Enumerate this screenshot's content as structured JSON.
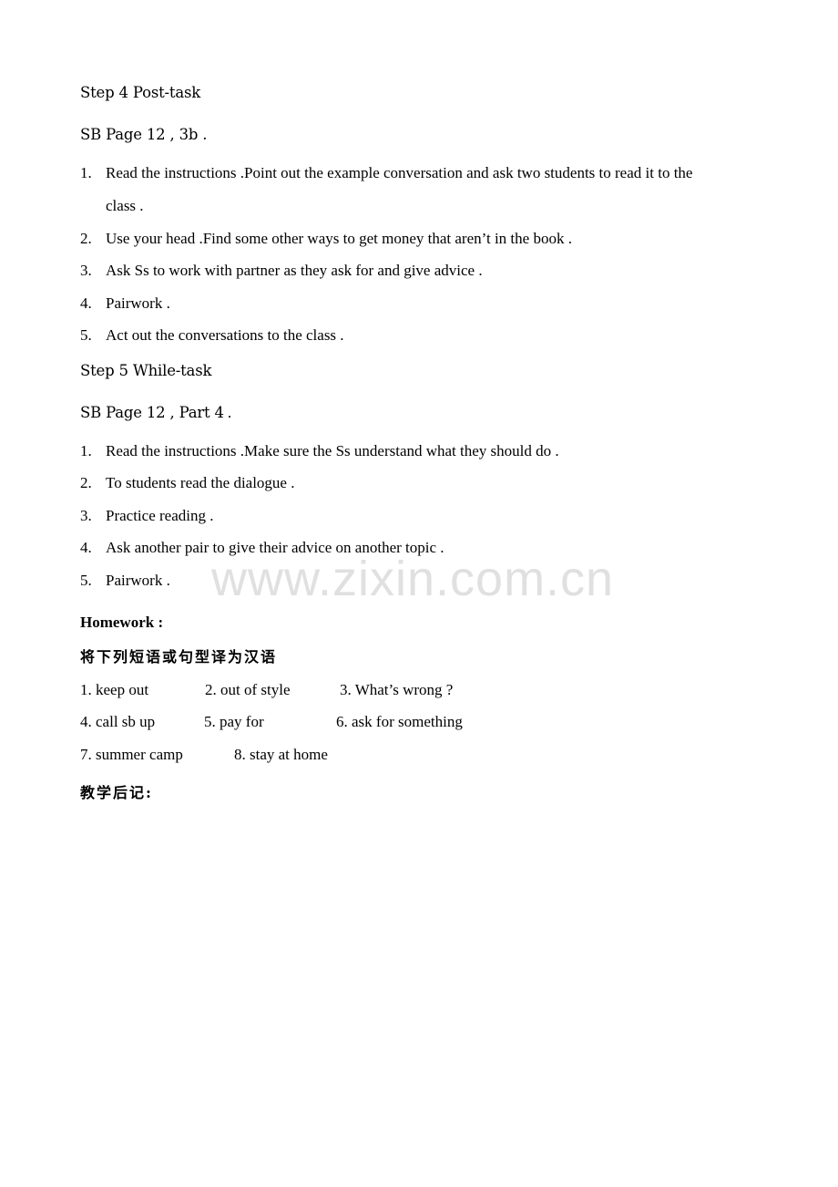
{
  "step4": {
    "title": "Step 4    Post-task",
    "subtitle": "SB Page 12 , 3b .",
    "items": [
      {
        "num": "1.",
        "text": "Read the instructions .Point out the example conversation and ask two students to read it to the",
        "cont": "class ."
      },
      {
        "num": "2.",
        "text": "Use your head .Find some other ways to get money that aren’t in the book ."
      },
      {
        "num": "3.",
        "text": "Ask Ss to work with partner as they ask for and give advice ."
      },
      {
        "num": "4.",
        "text": "Pairwork ."
      },
      {
        "num": "5.",
        "text": "Act out the conversations to the class ."
      }
    ]
  },
  "step5": {
    "title": "Step 5    While-task",
    "subtitle": "SB Page 12 , Part 4",
    "subtitle_end": " .",
    "items": [
      {
        "num": "1.",
        "text": "Read the instructions .Make sure the Ss understand what they should do ."
      },
      {
        "num": "2.",
        "text": "To students read the dialogue ."
      },
      {
        "num": "3.",
        "text": "Practice reading ."
      },
      {
        "num": "4.",
        "text": "Ask another pair to give their advice on another topic ."
      },
      {
        "num": "5.",
        "text": "Pairwork ."
      }
    ]
  },
  "watermark": "www.zixin.com.cn",
  "homework": {
    "title": "Homework :",
    "instruction": "将下列短语或句型译为汉语",
    "rows": [
      [
        "1. keep out",
        "2. out of style",
        "3. What’s wrong ?"
      ],
      [
        "4. call sb up",
        "5. pay for",
        "6. ask for something"
      ],
      [
        "7. summer camp",
        "8. stay at home"
      ]
    ]
  },
  "reflection_label": "教学后记:"
}
